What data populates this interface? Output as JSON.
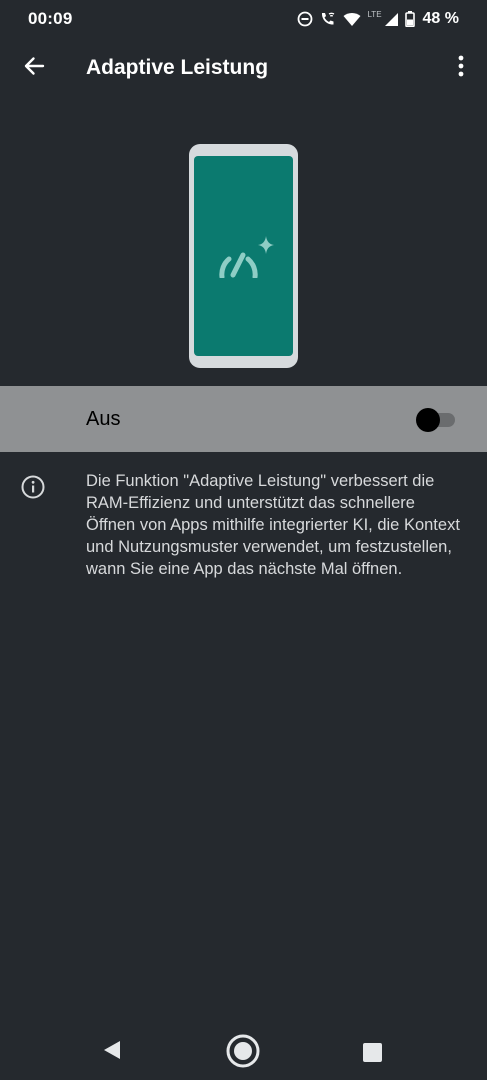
{
  "status_bar": {
    "time": "00:09",
    "network_label": "LTE",
    "battery": "48 %",
    "icons": [
      "do-not-disturb-icon",
      "wifi-calling-icon",
      "wifi-icon",
      "signal-icon",
      "battery-icon"
    ]
  },
  "app_bar": {
    "title": "Adaptive Leistung",
    "back_icon": "arrow-back-icon",
    "menu_icon": "more-vert-icon"
  },
  "illustration": {
    "icon": "adaptive-performance-icon",
    "screen_color": "#0b7a6f"
  },
  "toggle": {
    "label": "Aus",
    "state": "off"
  },
  "info": {
    "icon": "info-icon",
    "text": "Die Funktion \"Adaptive Leistung\" verbessert die RAM-Effizienz und unterstützt das schnellere Öffnen von Apps mithilfe integrierter KI, die Kontext und Nutzungsmuster verwendet, um festzustellen, wann Sie eine App das nächste Mal öffnen."
  },
  "nav_bar": {
    "icons": [
      "nav-back-icon",
      "nav-home-icon",
      "nav-recents-icon"
    ]
  }
}
